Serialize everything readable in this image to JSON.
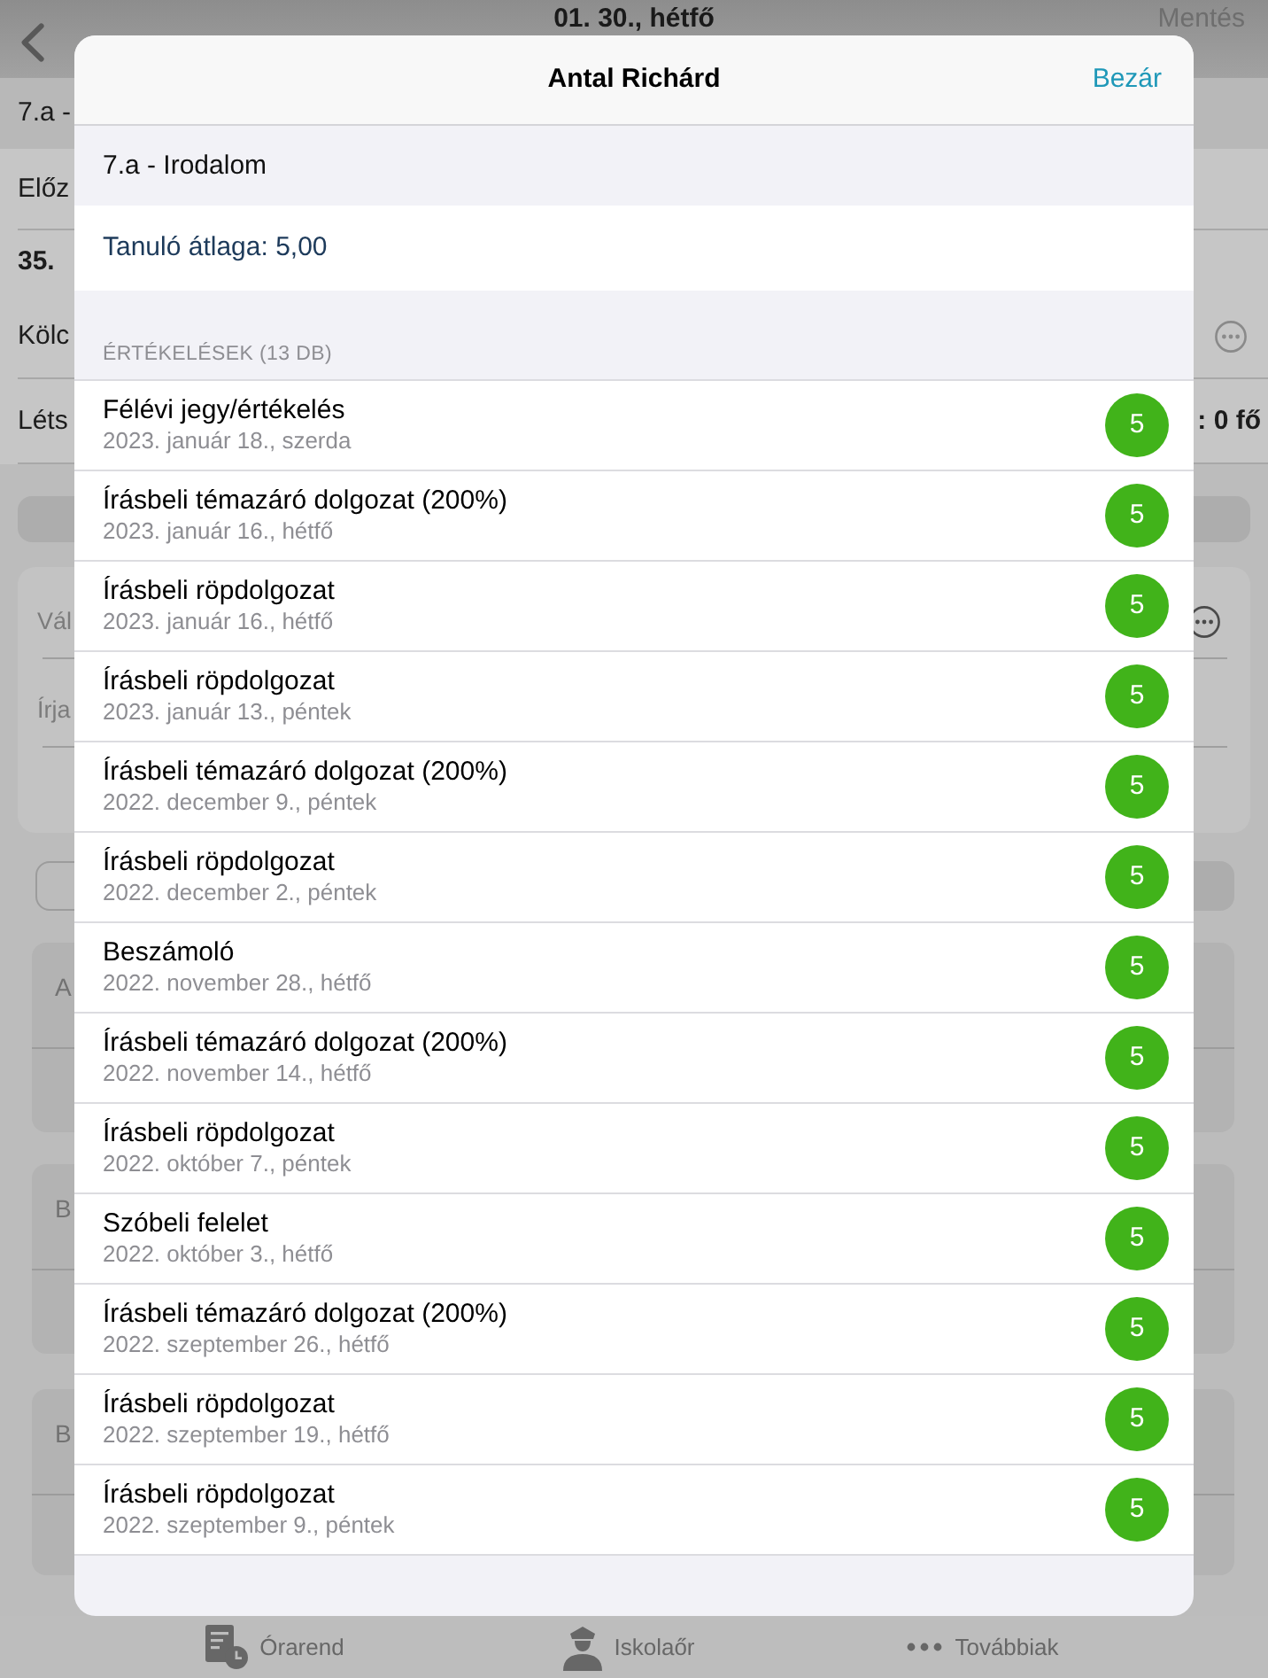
{
  "background": {
    "nav": {
      "title": "01. 30., hétfő",
      "action": "Mentés"
    },
    "header": "7.a -",
    "rows": [
      {
        "kind": "plain",
        "label": "Előz"
      },
      {
        "kind": "bold",
        "label": "35."
      },
      {
        "kind": "more",
        "label": "Kölc"
      },
      {
        "kind": "value",
        "label": "Léts",
        "value": ": 0 fő"
      }
    ],
    "fields": [
      {
        "kind": "more",
        "placeholder": "Vál"
      },
      {
        "kind": "plain",
        "placeholder": "Írja"
      }
    ],
    "cards": [
      {
        "label": "A"
      },
      {
        "label": "B"
      },
      {
        "label": "B"
      }
    ]
  },
  "tab_bar": [
    {
      "kind": "timetable",
      "label": "Órarend"
    },
    {
      "kind": "guard",
      "label": "Iskolaőr"
    },
    {
      "kind": "more",
      "label": "Továbbiak"
    }
  ],
  "dialog": {
    "title": "Antal Richárd",
    "close": "Bezár",
    "subtitle": "7.a - Irodalom",
    "average": "Tanuló átlaga: 5,00",
    "section_header": "ÉRTÉKELÉSEK (13 DB)",
    "grades": [
      {
        "title": "Félévi jegy/értékelés",
        "date": "2023. január 18., szerda",
        "grade": "5"
      },
      {
        "title": "Írásbeli témazáró dolgozat (200%)",
        "date": "2023. január 16., hétfő",
        "grade": "5"
      },
      {
        "title": "Írásbeli röpdolgozat",
        "date": "2023. január 16., hétfő",
        "grade": "5"
      },
      {
        "title": "Írásbeli röpdolgozat",
        "date": "2023. január 13., péntek",
        "grade": "5"
      },
      {
        "title": "Írásbeli témazáró dolgozat (200%)",
        "date": "2022. december 9., péntek",
        "grade": "5"
      },
      {
        "title": "Írásbeli röpdolgozat",
        "date": "2022. december 2., péntek",
        "grade": "5"
      },
      {
        "title": "Beszámoló",
        "date": "2022. november 28., hétfő",
        "grade": "5"
      },
      {
        "title": "Írásbeli témazáró dolgozat (200%)",
        "date": "2022. november 14., hétfő",
        "grade": "5"
      },
      {
        "title": "Írásbeli röpdolgozat",
        "date": "2022. október 7., péntek",
        "grade": "5"
      },
      {
        "title": "Szóbeli felelet",
        "date": "2022. október 3., hétfő",
        "grade": "5"
      },
      {
        "title": "Írásbeli témazáró dolgozat (200%)",
        "date": "2022. szeptember 26., hétfő",
        "grade": "5"
      },
      {
        "title": "Írásbeli röpdolgozat",
        "date": "2022. szeptember 19., hétfő",
        "grade": "5"
      },
      {
        "title": "Írásbeli röpdolgozat",
        "date": "2022. szeptember 9., péntek",
        "grade": "5"
      }
    ]
  }
}
